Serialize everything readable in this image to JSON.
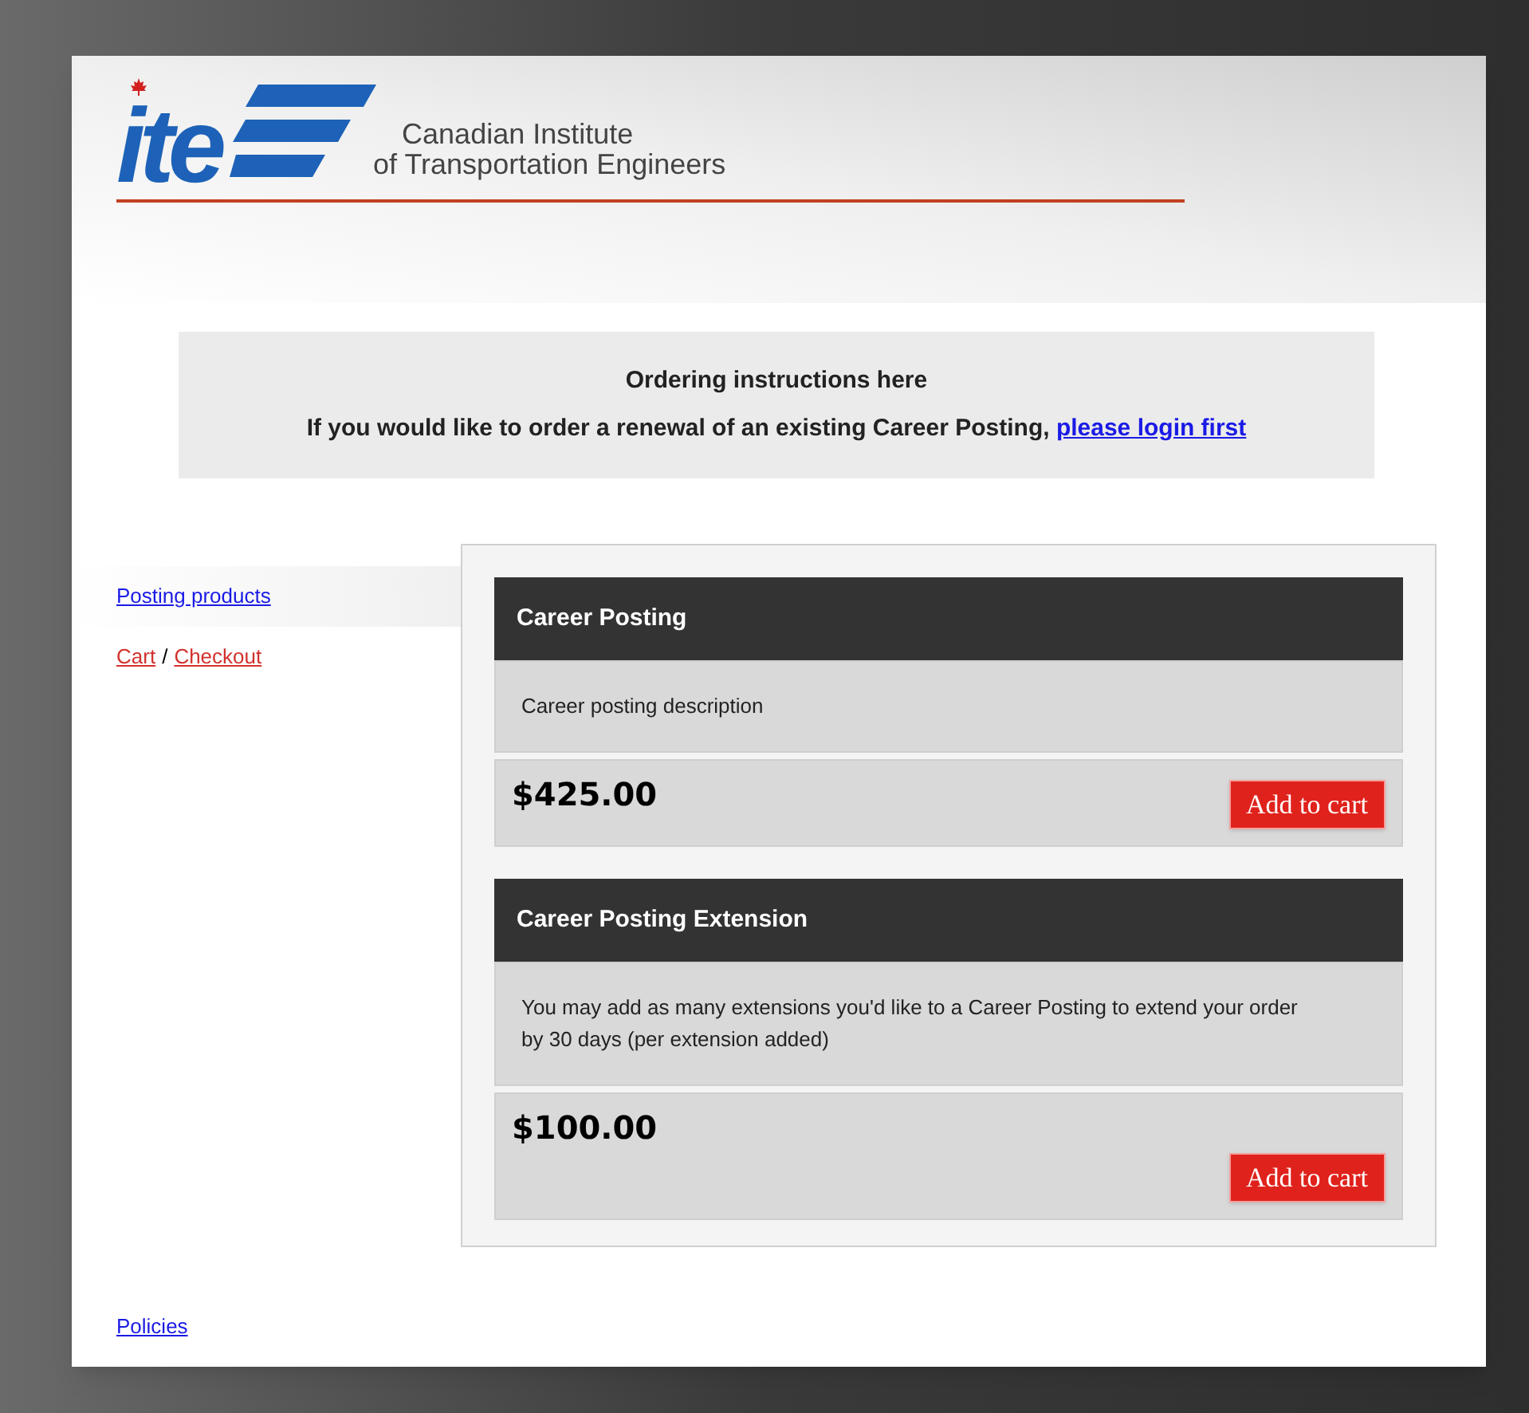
{
  "header": {
    "logo_text": "ite",
    "org_name": [
      "Canadian Institute",
      "of Transportation Engineers"
    ]
  },
  "notice": {
    "title": "Ordering instructions here",
    "text": "If you would like to order a renewal of an existing Career Posting,",
    "link": "please login first"
  },
  "sidebar": {
    "items": [
      {
        "kind": "nav",
        "label": "Posting products",
        "selected": true
      },
      {
        "kind": "pair",
        "links": [
          "Cart",
          "Checkout"
        ],
        "separator": "/",
        "selected": false
      }
    ]
  },
  "products": [
    {
      "name": "Career Posting",
      "description": "Career posting description",
      "price": "$425.00",
      "button": "Add to cart"
    },
    {
      "name": "Career Posting Extension",
      "description": "You may add as many extensions you'd like to a Career Posting to extend your order by 30 days (per extension added)",
      "price": "$100.00",
      "button": "Add to cart"
    }
  ],
  "footer_link": "Policies"
}
